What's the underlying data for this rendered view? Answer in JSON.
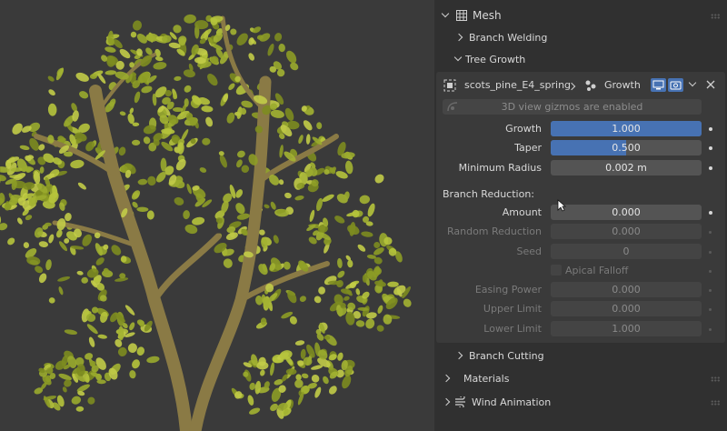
{
  "panel": {
    "mesh_label": "Mesh",
    "branch_welding_label": "Branch Welding",
    "tree_growth_label": "Tree Growth",
    "node": {
      "object_name": "scots_pine_E4_spring",
      "modifier_name": "Growth"
    },
    "gizmo_notice": "3D view gizmos are enabled",
    "fields": {
      "growth": {
        "label": "Growth",
        "value": "1.000",
        "fill": 1.0
      },
      "taper": {
        "label": "Taper",
        "value": "0.500",
        "fill": 0.5
      },
      "min_radius": {
        "label": "Minimum Radius",
        "value": "0.002 m"
      }
    },
    "branch_reduction_label": "Branch Reduction:",
    "reduction": {
      "amount": {
        "label": "Amount",
        "value": "0.000"
      },
      "random_reduction": {
        "label": "Random Reduction",
        "value": "0.000"
      },
      "seed": {
        "label": "Seed",
        "value": "0"
      },
      "apical_falloff": {
        "label": "Apical Falloff"
      },
      "easing_power": {
        "label": "Easing Power",
        "value": "0.000"
      },
      "upper_limit": {
        "label": "Upper Limit",
        "value": "0.000"
      },
      "lower_limit": {
        "label": "Lower Limit",
        "value": "1.000"
      }
    },
    "branch_cutting_label": "Branch Cutting",
    "materials_label": "Materials",
    "wind_animation_label": "Wind Animation"
  },
  "colors": {
    "accent": "#4772b3",
    "panel_bg": "#303030",
    "subpanel_bg": "#3a3a3a",
    "foliage": "#a3b232"
  }
}
